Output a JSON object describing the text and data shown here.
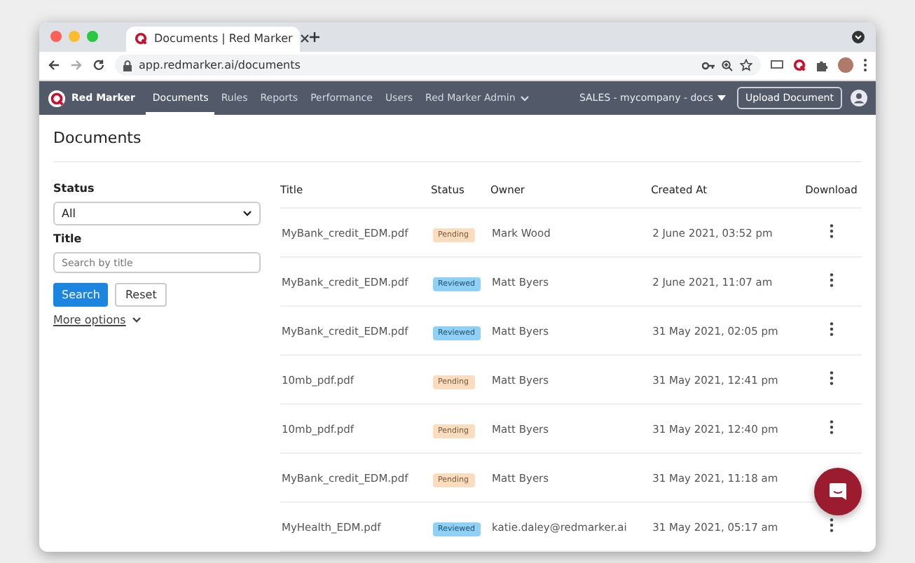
{
  "browser": {
    "tab_title": "Documents | Red Marker",
    "url": "app.redmarker.ai/documents"
  },
  "nav": {
    "brand": "Red Marker",
    "items": [
      {
        "label": "Documents",
        "selected": true,
        "dropdown": false
      },
      {
        "label": "Rules",
        "selected": false,
        "dropdown": false
      },
      {
        "label": "Reports",
        "selected": false,
        "dropdown": false
      },
      {
        "label": "Performance",
        "selected": false,
        "dropdown": false
      },
      {
        "label": "Users",
        "selected": false,
        "dropdown": false
      },
      {
        "label": "Red Marker Admin",
        "selected": false,
        "dropdown": true
      }
    ],
    "workspace": "SALES - mycompany - docs",
    "upload_button": "Upload Document"
  },
  "page": {
    "title": "Documents"
  },
  "filters": {
    "status_label": "Status",
    "status_value": "All",
    "title_label": "Title",
    "title_placeholder": "Search by title",
    "search_button": "Search",
    "reset_button": "Reset",
    "more_options": "More options"
  },
  "table": {
    "columns": [
      "Title",
      "Status",
      "Owner",
      "Created At",
      "Download"
    ],
    "rows": [
      {
        "title": "MyBank_credit_EDM.pdf",
        "status": {
          "label": "Pending",
          "kind": "pending"
        },
        "owner": "Mark Wood",
        "created_at": "2 June 2021, 03:52 pm"
      },
      {
        "title": "MyBank_credit_EDM.pdf",
        "status": {
          "label": "Reviewed",
          "kind": "reviewed"
        },
        "owner": "Matt Byers",
        "created_at": "2 June 2021, 11:07 am"
      },
      {
        "title": "MyBank_credit_EDM.pdf",
        "status": {
          "label": "Reviewed",
          "kind": "reviewed"
        },
        "owner": "Matt Byers",
        "created_at": "31 May 2021, 02:05 pm"
      },
      {
        "title": "10mb_pdf.pdf",
        "status": {
          "label": "Pending",
          "kind": "pending"
        },
        "owner": "Matt Byers",
        "created_at": "31 May 2021, 12:41 pm"
      },
      {
        "title": "10mb_pdf.pdf",
        "status": {
          "label": "Pending",
          "kind": "pending"
        },
        "owner": "Matt Byers",
        "created_at": "31 May 2021, 12:40 pm"
      },
      {
        "title": "MyBank_credit_EDM.pdf",
        "status": {
          "label": "Pending",
          "kind": "pending"
        },
        "owner": "Matt Byers",
        "created_at": "31 May 2021, 11:18 am"
      },
      {
        "title": "MyHealth_EDM.pdf",
        "status": {
          "label": "Reviewed",
          "kind": "reviewed"
        },
        "owner": "katie.daley@redmarker.ai",
        "created_at": "31 May 2021, 05:17 am"
      }
    ]
  }
}
